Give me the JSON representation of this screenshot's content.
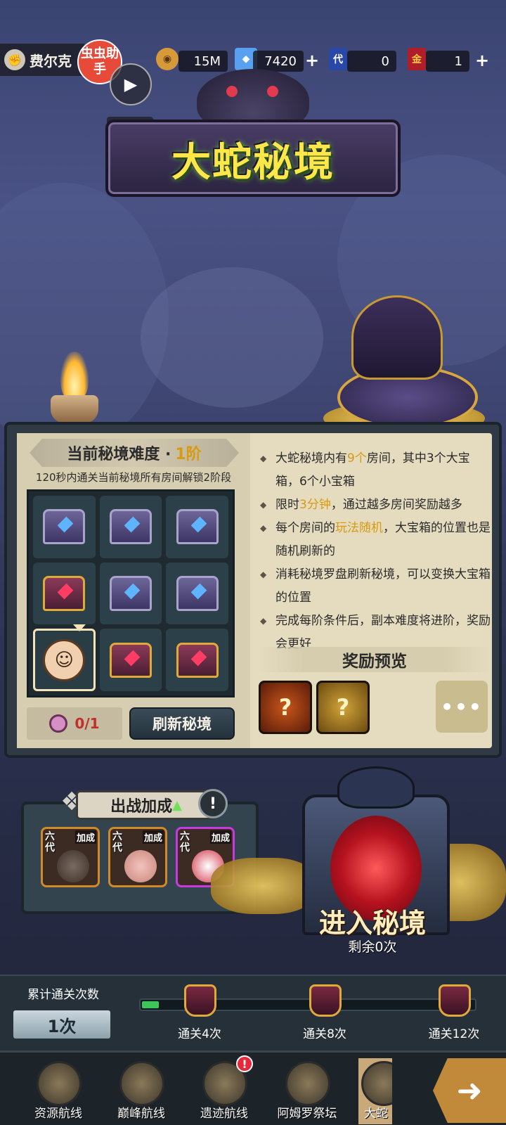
{
  "topbar": {
    "player_name": "费尔克",
    "coins": "15M",
    "gems": "7420",
    "ticket_dai": "0",
    "ticket_jin": "1",
    "dai_label": "代",
    "jin_label": "金"
  },
  "overlay": {
    "assistant_label": "虫虫助手",
    "expand_label": "展开"
  },
  "title": "大蛇秘境",
  "difficulty": {
    "label": "当前秘境难度 · ",
    "level": "1阶",
    "subtitle": "120秒内通关当前秘境所有房间解锁2阶段"
  },
  "grid": {
    "cells": [
      "small",
      "small",
      "small",
      "big",
      "small",
      "small",
      "hero",
      "big",
      "big"
    ]
  },
  "compass": {
    "count": "0/1"
  },
  "refresh_label": "刷新秘境",
  "rules": [
    {
      "pre": "大蛇秘境内有",
      "hl": "9个",
      "post": "房间，其中3个大宝箱，6个小宝箱"
    },
    {
      "pre": "限时",
      "hl": "3分钟",
      "post": "，通过越多房间奖励越多"
    },
    {
      "pre": "每个房间的",
      "hl": "玩法随机",
      "post": "，大宝箱的位置也是随机刷新的"
    },
    {
      "pre": "消耗秘境罗盘刷新秘境，可以变换大宝箱的位置",
      "hl": "",
      "post": ""
    },
    {
      "pre": "完成每阶条件后，副本难度将进阶，奖励会更好",
      "hl": "",
      "post": ""
    }
  ],
  "rewards": {
    "title": "奖励预览",
    "more": "•••"
  },
  "boost": {
    "title": "出战加成",
    "cards": [
      {
        "gen": "六代",
        "tag": "加成"
      },
      {
        "gen": "六代",
        "tag": "加成"
      },
      {
        "gen": "六代",
        "tag": "加成"
      }
    ]
  },
  "enter": {
    "label": "进入秘境",
    "remaining": "剩余0次"
  },
  "progress": {
    "cum_label": "累计通关次数",
    "cum_value": "1次",
    "fraction": 0.05,
    "milestones": [
      "通关4次",
      "通关8次",
      "通关12次"
    ]
  },
  "nav": {
    "items": [
      "资源航线",
      "巅峰航线",
      "遗迹航线",
      "阿姆罗祭坛",
      "大蛇"
    ],
    "badge": "!"
  },
  "colors": {
    "highlight": "#d89a10",
    "progress_fill": "#3ec45a",
    "title": "#ffe74a"
  }
}
